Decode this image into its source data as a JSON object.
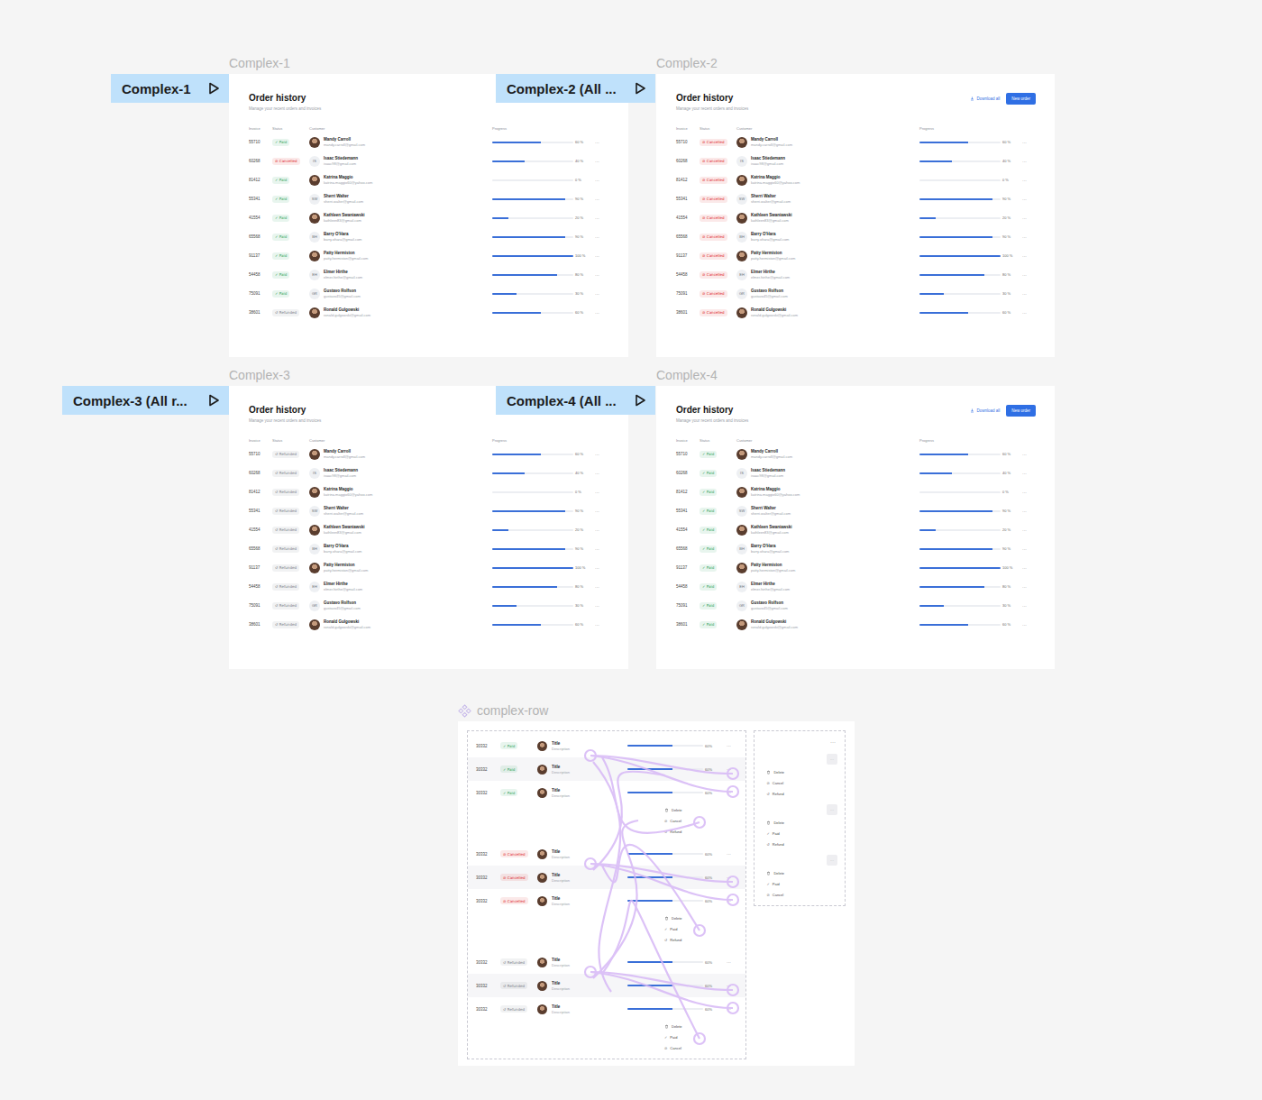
{
  "canvas": {
    "component_label": "complex-row"
  },
  "status_kinds": [
    {
      "label": "Paid",
      "icon": "✓",
      "color": "#1f9d55"
    },
    {
      "label": "Cancelled",
      "icon": "⊘",
      "color": "#dc2626"
    },
    {
      "label": "Refunded",
      "icon": "↺",
      "color": "#7a7f87"
    }
  ],
  "order_history": {
    "title": "Order history",
    "subtitle": "Manage your recent orders and invoices",
    "columns": [
      "Invoice",
      "Status",
      "Customer",
      "Progress"
    ],
    "download": "Download all",
    "new_order": "New order",
    "more": "···"
  },
  "orders": [
    {
      "invoice": "55710",
      "customer": "Mandy Carroll",
      "email": "mandy.carroll@gmail.com",
      "avatar": "photo",
      "level": 0.6,
      "percent": "60 %"
    },
    {
      "invoice": "60268",
      "customer": "Isaac Stiedemann",
      "email": "isaac98@gmail.com",
      "avatar": "initials",
      "initials": "IS",
      "level": 0.4,
      "percent": "40 %"
    },
    {
      "invoice": "81412",
      "customer": "Katrina Maggio",
      "email": "katrina.maggio60@yahoo.com",
      "avatar": "photo",
      "level": 0,
      "percent": "0 %"
    },
    {
      "invoice": "55341",
      "customer": "Sherri Walter",
      "email": "sherri.walter@gmail.com",
      "avatar": "initials",
      "initials": "SW",
      "level": 0.9,
      "percent": "90 %"
    },
    {
      "invoice": "41554",
      "customer": "Kathleen Swaniawski",
      "email": "kathleen83@gmail.com",
      "avatar": "photo",
      "level": 0.2,
      "percent": "20 %"
    },
    {
      "invoice": "65568",
      "customer": "Barry O'Hara",
      "email": "barry.ohara@gmail.com",
      "avatar": "initials",
      "initials": "BH",
      "level": 0.9,
      "percent": "90 %"
    },
    {
      "invoice": "91137",
      "customer": "Patty Hermiston",
      "email": "patty.hermiston@gmail.com",
      "avatar": "photo",
      "level": 1,
      "percent": "100 %"
    },
    {
      "invoice": "54458",
      "customer": "Elmer Hirthe",
      "email": "elmer.hirthe@gmail.com",
      "avatar": "initials",
      "initials": "EH",
      "level": 0.8,
      "percent": "80 %"
    },
    {
      "invoice": "75091",
      "customer": "Gustavo Rolfson",
      "email": "gustavo45@gmail.com",
      "avatar": "initials",
      "initials": "GR",
      "level": 0.3,
      "percent": "30 %"
    },
    {
      "invoice": "38601",
      "customer": "Ronald Gulgowski",
      "email": "ronald.gulgowski@gmail.com",
      "avatar": "photo",
      "level": 0.6,
      "percent": "60 %"
    }
  ],
  "frames": [
    {
      "label": "Complex-1",
      "flow": "Complex-1",
      "header_actions": false,
      "statuses": [
        "Paid",
        "Cancelled",
        "Paid",
        "Paid",
        "Paid",
        "Paid",
        "Paid",
        "Paid",
        "Paid",
        "Refunded"
      ]
    },
    {
      "label": "Complex-2",
      "flow": "Complex-2 (All ...",
      "header_actions": true,
      "statuses": [
        "Cancelled",
        "Cancelled",
        "Cancelled",
        "Cancelled",
        "Cancelled",
        "Cancelled",
        "Cancelled",
        "Cancelled",
        "Cancelled",
        "Cancelled"
      ]
    },
    {
      "label": "Complex-3",
      "flow": "Complex-3 (All r...",
      "header_actions": false,
      "statuses": [
        "Refunded",
        "Refunded",
        "Refunded",
        "Refunded",
        "Refunded",
        "Refunded",
        "Refunded",
        "Refunded",
        "Refunded",
        "Refunded"
      ]
    },
    {
      "label": "Complex-4",
      "flow": "Complex-4 (All ...",
      "header_actions": true,
      "statuses": [
        "Paid",
        "Paid",
        "Paid",
        "Paid",
        "Paid",
        "Paid",
        "Paid",
        "Paid",
        "Paid",
        "Paid"
      ]
    }
  ],
  "component": {
    "more": "···",
    "groups": [
      {
        "rows": [
          {
            "invoice": "30332",
            "status": "Paid",
            "title": "Title",
            "description": "Description",
            "level": 0.6,
            "percent": "60%",
            "highlighted": false
          },
          {
            "invoice": "30332",
            "status": "Paid",
            "title": "Title",
            "description": "Description",
            "level": 0.6,
            "percent": "60%",
            "highlighted": true
          },
          {
            "invoice": "30332",
            "status": "Paid",
            "title": "Title",
            "description": "Description",
            "level": 0.6,
            "percent": "60%",
            "highlighted": false
          }
        ],
        "menu": [
          {
            "label": "Delete",
            "kind": "delete"
          },
          {
            "label": "Cancel",
            "kind": "status",
            "icon": "⊘"
          },
          {
            "label": "Refund",
            "kind": "status",
            "icon": "↺"
          }
        ]
      },
      {
        "rows": [
          {
            "invoice": "30332",
            "status": "Cancelled",
            "title": "Title",
            "description": "Description",
            "level": 0.6,
            "percent": "60%",
            "highlighted": false
          },
          {
            "invoice": "30332",
            "status": "Cancelled",
            "title": "Title",
            "description": "Description",
            "level": 0.6,
            "percent": "60%",
            "highlighted": true
          },
          {
            "invoice": "30332",
            "status": "Cancelled",
            "title": "Title",
            "description": "Description",
            "level": 0.6,
            "percent": "60%",
            "highlighted": false
          }
        ],
        "menu": [
          {
            "label": "Delete",
            "kind": "delete"
          },
          {
            "label": "Paid",
            "kind": "status",
            "icon": "✓"
          },
          {
            "label": "Refund",
            "kind": "status",
            "icon": "↺"
          }
        ]
      },
      {
        "rows": [
          {
            "invoice": "30332",
            "status": "Refunded",
            "title": "Title",
            "description": "Description",
            "level": 0.6,
            "percent": "60%",
            "highlighted": false
          },
          {
            "invoice": "30332",
            "status": "Refunded",
            "title": "Title",
            "description": "Description",
            "level": 0.6,
            "percent": "60%",
            "highlighted": true
          },
          {
            "invoice": "30332",
            "status": "Refunded",
            "title": "Title",
            "description": "Description",
            "level": 0.6,
            "percent": "60%",
            "highlighted": false
          }
        ],
        "menu": [
          {
            "label": "Delete",
            "kind": "delete"
          },
          {
            "label": "Paid",
            "kind": "status",
            "icon": "✓"
          },
          {
            "label": "Cancel",
            "kind": "status",
            "icon": "⊘"
          }
        ]
      }
    ],
    "variants": [
      {
        "menu": [
          {
            "label": "Delete",
            "kind": "delete"
          },
          {
            "label": "Cancel",
            "kind": "status",
            "icon": "⊘"
          },
          {
            "label": "Refund",
            "kind": "status",
            "icon": "↺"
          }
        ]
      },
      {
        "menu": [
          {
            "label": "Delete",
            "kind": "delete"
          },
          {
            "label": "Paid",
            "kind": "status",
            "icon": "✓"
          },
          {
            "label": "Refund",
            "kind": "status",
            "icon": "↺"
          }
        ]
      },
      {
        "menu": [
          {
            "label": "Delete",
            "kind": "delete"
          },
          {
            "label": "Paid",
            "kind": "status",
            "icon": "✓"
          },
          {
            "label": "Cancel",
            "kind": "status",
            "icon": "⊘"
          }
        ]
      }
    ]
  }
}
